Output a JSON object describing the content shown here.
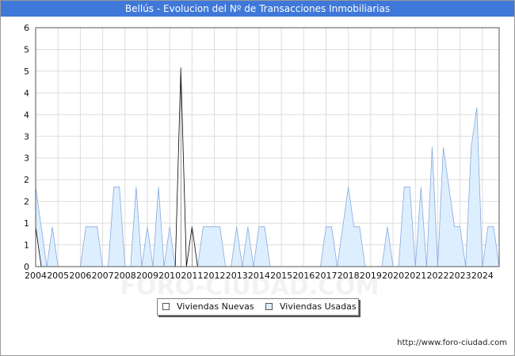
{
  "title": "Bellús - Evolucion del Nº de Transacciones Inmobiliarias",
  "source": "http://www.foro-ciudad.com",
  "watermark": "FORO-CIUDAD.COM",
  "legend": [
    {
      "label": "Viviendas Nuevas",
      "color": "#ffffff"
    },
    {
      "label": "Viviendas Usadas",
      "color": "#ddeeff"
    }
  ],
  "chart_data": {
    "type": "area",
    "title": "Bellús - Evolucion del Nº de Transacciones Inmobiliarias",
    "xlabel": "",
    "ylabel": "",
    "ylim": [
      0,
      6
    ],
    "y_ticks": [
      "0",
      "1",
      "1",
      "2",
      "2",
      "3",
      "3",
      "4",
      "4",
      "5",
      "5",
      "6"
    ],
    "x_ticks": [
      "2004",
      "2005",
      "2006",
      "2007",
      "2008",
      "2009",
      "2010",
      "2011",
      "2012",
      "2013",
      "2014",
      "2015",
      "2016",
      "2017",
      "2018",
      "2019",
      "2020",
      "2021",
      "2022",
      "2023",
      "2024"
    ],
    "x_range": [
      2004.0,
      2024.75
    ],
    "grid": true,
    "legend_position": "bottom",
    "series": [
      {
        "name": "Viviendas Nuevas",
        "fill": "#ffffff",
        "stroke": "#000000",
        "x": [
          2004.0,
          2004.25,
          2010.25,
          2010.5,
          2010.75,
          2011.0,
          2011.25
        ],
        "values": [
          1,
          0,
          0,
          5,
          0,
          1,
          0
        ]
      },
      {
        "name": "Viviendas Usadas",
        "fill": "#ddeeff",
        "stroke": "#88aadd",
        "x": [
          2004.0,
          2004.25,
          2004.5,
          2004.75,
          2005.0,
          2005.25,
          2005.5,
          2005.75,
          2006.0,
          2006.25,
          2006.5,
          2006.75,
          2007.0,
          2007.25,
          2007.5,
          2007.75,
          2008.0,
          2008.25,
          2008.5,
          2008.75,
          2009.0,
          2009.25,
          2009.5,
          2009.75,
          2010.0,
          2010.25,
          2010.5,
          2010.75,
          2011.0,
          2011.25,
          2011.5,
          2011.75,
          2012.0,
          2012.25,
          2012.5,
          2012.75,
          2013.0,
          2013.25,
          2013.5,
          2013.75,
          2014.0,
          2014.25,
          2014.5,
          2014.75,
          2015.0,
          2015.25,
          2015.5,
          2015.75,
          2016.0,
          2016.25,
          2016.5,
          2016.75,
          2017.0,
          2017.25,
          2017.5,
          2017.75,
          2018.0,
          2018.25,
          2018.5,
          2018.75,
          2019.0,
          2019.25,
          2019.5,
          2019.75,
          2020.0,
          2020.25,
          2020.5,
          2020.75,
          2021.0,
          2021.25,
          2021.5,
          2021.75,
          2022.0,
          2022.25,
          2022.5,
          2022.75,
          2023.0,
          2023.25,
          2023.5,
          2023.75,
          2024.0,
          2024.25,
          2024.5,
          2024.75
        ],
        "values": [
          2,
          1,
          0,
          1,
          0,
          0,
          0,
          0,
          0,
          1,
          1,
          1,
          0,
          0,
          2,
          2,
          0,
          0,
          2,
          0,
          1,
          0,
          2,
          0,
          1,
          0,
          0,
          0,
          0,
          0,
          1,
          1,
          1,
          1,
          0,
          0,
          1,
          0,
          1,
          0,
          1,
          1,
          0,
          0,
          0,
          0,
          0,
          0,
          0,
          0,
          0,
          0,
          1,
          1,
          0,
          1,
          2,
          1,
          1,
          0,
          0,
          0,
          0,
          1,
          0,
          0,
          2,
          2,
          0,
          2,
          0,
          3,
          0,
          3,
          2,
          1,
          1,
          0,
          3,
          4,
          0,
          1,
          1,
          0
        ]
      }
    ]
  }
}
